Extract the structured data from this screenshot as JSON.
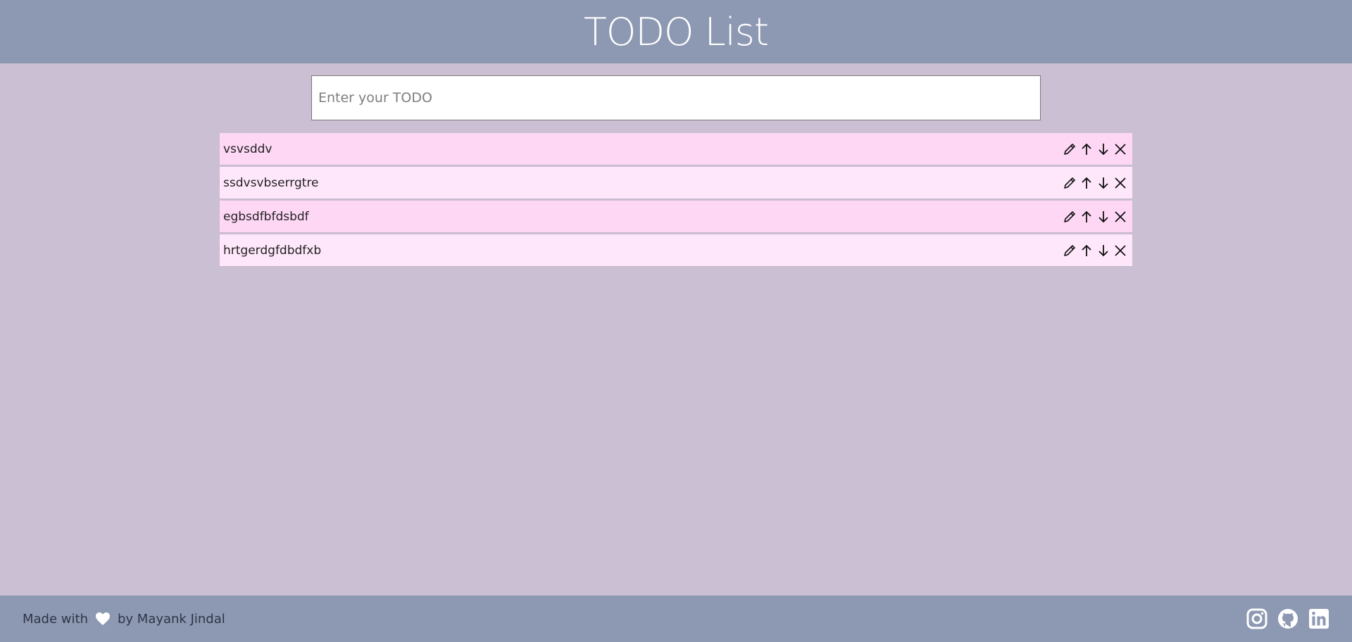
{
  "header": {
    "title": "TODO List"
  },
  "input": {
    "placeholder": "Enter your TODO",
    "value": ""
  },
  "todos": [
    {
      "text": "vsvsddv"
    },
    {
      "text": "ssdvsvbserrgtre"
    },
    {
      "text": "egbsdfbfdsbdf"
    },
    {
      "text": "hrtgerdgfdbdfxb"
    }
  ],
  "item_actions": [
    "pencil-icon",
    "arrow-up-icon",
    "arrow-down-icon",
    "close-icon"
  ],
  "footer": {
    "made_with": "Made with",
    "by": "by Mayank Jindal",
    "heart_icon": "heart-icon",
    "social": [
      "instagram-icon",
      "github-icon",
      "linkedin-icon"
    ]
  },
  "colors": {
    "header_bg": "#8d99b2",
    "page_bg": "#cbbfd3",
    "item_odd_bg": "#fed7f5",
    "item_even_bg": "#ffe7fb"
  }
}
